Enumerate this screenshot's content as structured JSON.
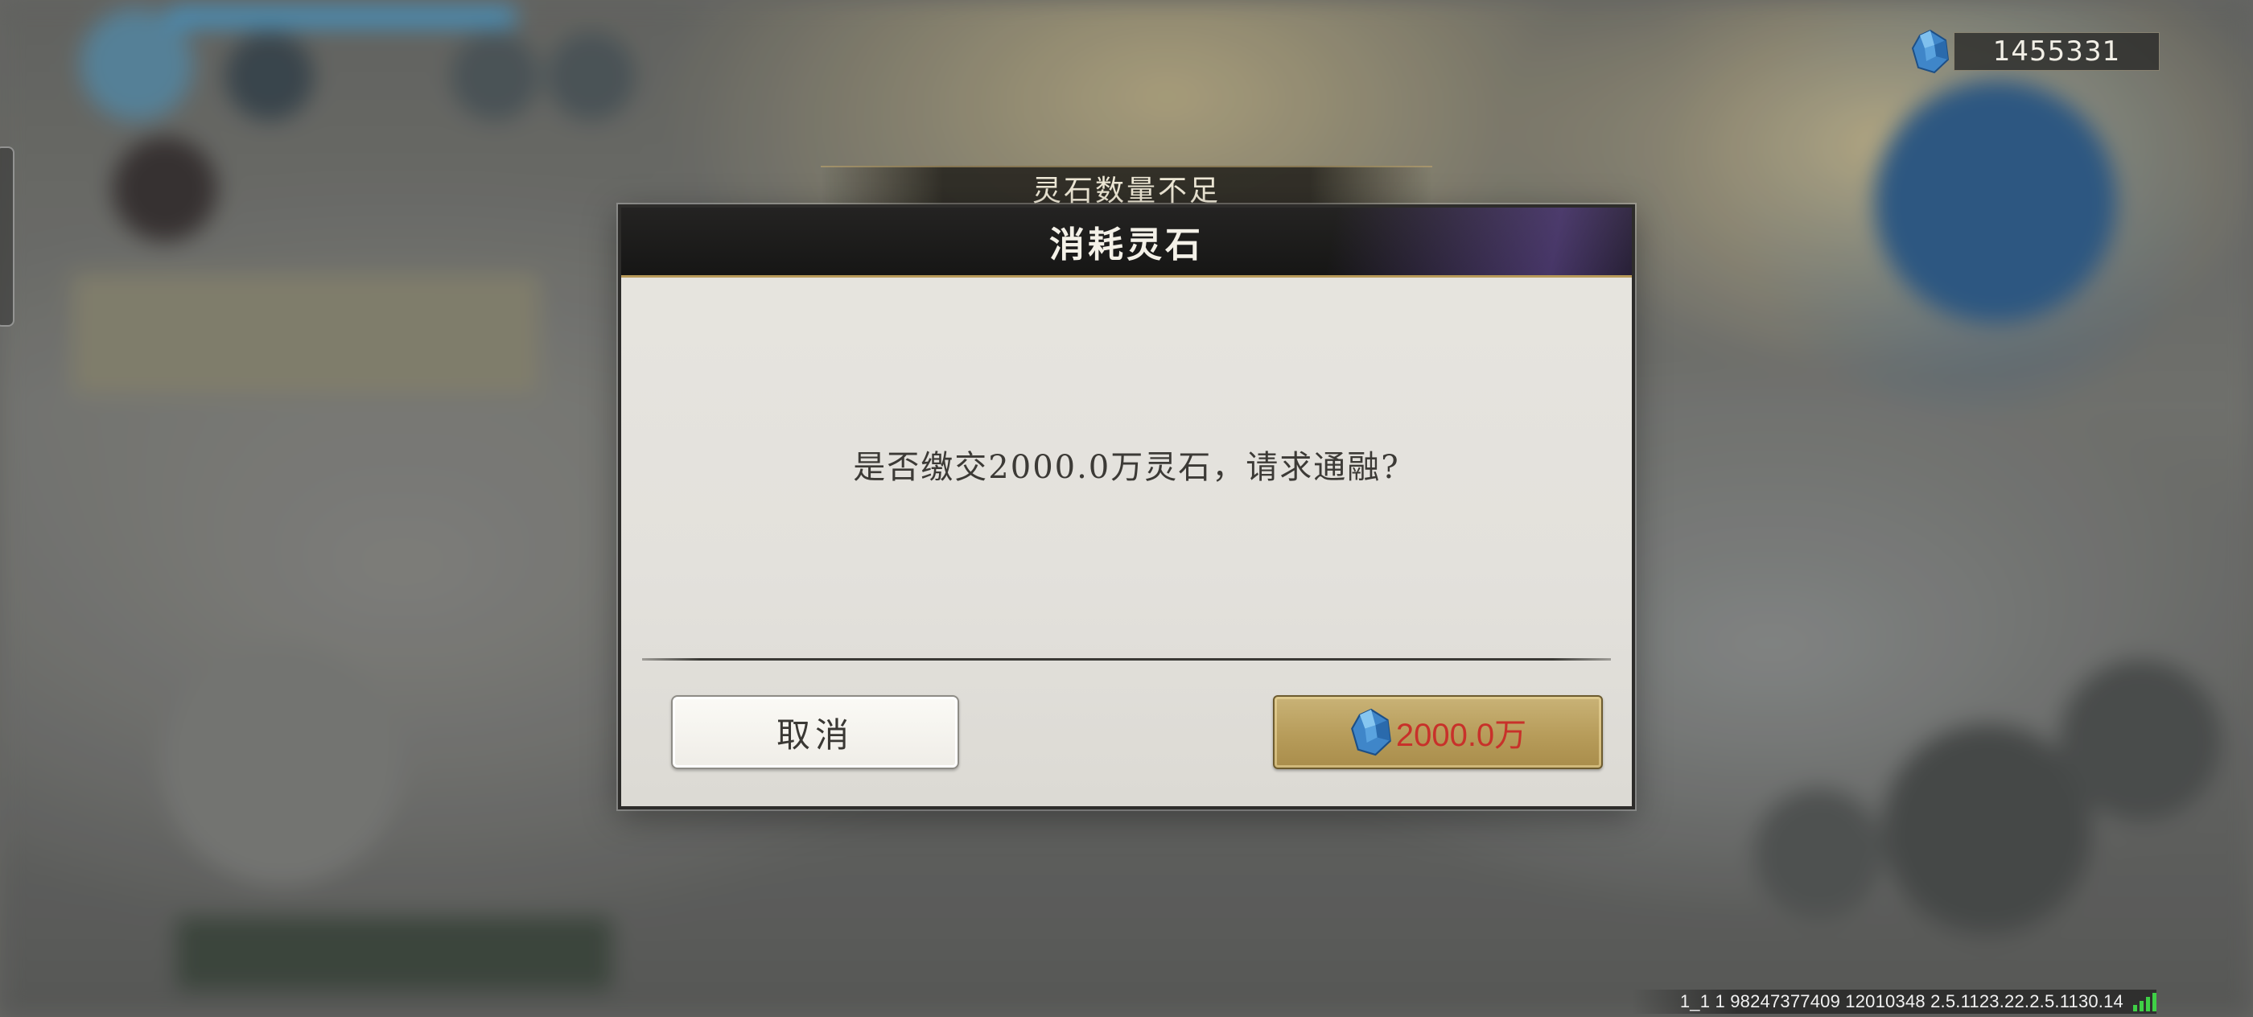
{
  "currency": {
    "icon": "spirit-stone-icon",
    "amount": "1455331"
  },
  "dialog": {
    "subtitle": "灵石数量不足",
    "title": "消耗灵石",
    "message": "是否缴交2000.0万灵石，请求通融?",
    "cancel_label": "取消",
    "confirm_price": "2000.0万",
    "confirm_icon": "spirit-stone-icon"
  },
  "build_info": {
    "text": "1_1 1 98247377409  12010348  2.5.1123.22.2.5.1130.14",
    "signal_icon": "signal-strength-icon"
  },
  "colors": {
    "price_red": "#c8312a",
    "confirm_gold": "#b79c5a",
    "header_dark": "#1c1b1a",
    "signal_green": "#3fd046"
  }
}
